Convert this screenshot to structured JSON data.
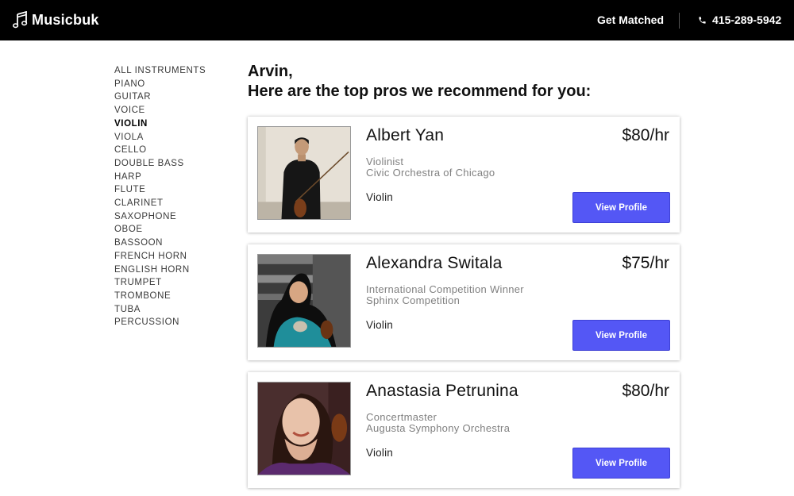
{
  "header": {
    "brand": "Musicbuk",
    "get_matched": "Get Matched",
    "phone": "415-289-5942",
    "icons": [
      "music-note-icon",
      "phone-icon"
    ]
  },
  "sidebar": {
    "items": [
      {
        "label": "ALL INSTRUMENTS"
      },
      {
        "label": "PIANO"
      },
      {
        "label": "GUITAR"
      },
      {
        "label": "VOICE"
      },
      {
        "label": "VIOLIN",
        "active": true
      },
      {
        "label": "VIOLA"
      },
      {
        "label": "CELLO"
      },
      {
        "label": "DOUBLE BASS"
      },
      {
        "label": "HARP"
      },
      {
        "label": "FLUTE"
      },
      {
        "label": "CLARINET"
      },
      {
        "label": "SAXOPHONE"
      },
      {
        "label": "OBOE"
      },
      {
        "label": "BASSOON"
      },
      {
        "label": "FRENCH HORN"
      },
      {
        "label": "ENGLISH HORN"
      },
      {
        "label": "TRUMPET"
      },
      {
        "label": "TROMBONE"
      },
      {
        "label": "TUBA"
      },
      {
        "label": "PERCUSSION"
      }
    ]
  },
  "main": {
    "greeting_name": "Arvin,",
    "greeting_text": "Here are the top pros we recommend for you:",
    "pros": [
      {
        "name": "Albert Yan",
        "rate": "$80/hr",
        "title_line1": "Violinist",
        "title_line2": "Civic Orchestra of Chicago",
        "instrument": "Violin",
        "button": "View Profile"
      },
      {
        "name": "Alexandra Switala",
        "rate": "$75/hr",
        "title_line1": "International Competition Winner",
        "title_line2": "Sphinx Competition",
        "instrument": "Violin",
        "button": "View Profile"
      },
      {
        "name": "Anastasia Petrunina",
        "rate": "$80/hr",
        "title_line1": "Concertmaster",
        "title_line2": "Augusta Symphony Orchestra",
        "instrument": "Violin",
        "button": "View Profile"
      }
    ]
  },
  "colors": {
    "header_bg": "#000000",
    "button_bg": "#5457f5",
    "muted_text": "#808080"
  }
}
